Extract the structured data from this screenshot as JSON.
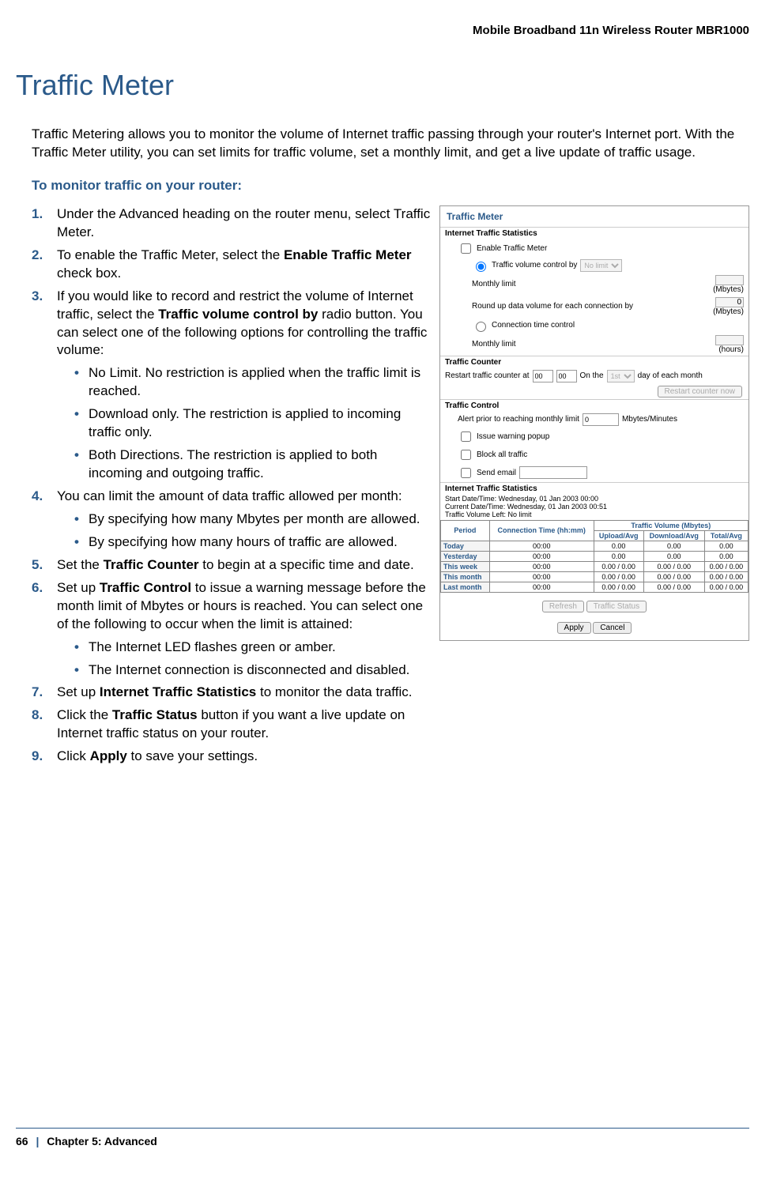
{
  "header": {
    "product": "Mobile Broadband 11n Wireless Router MBR1000"
  },
  "title": "Traffic Meter",
  "intro": "Traffic Metering allows you to monitor the volume of Internet traffic passing through your router's Internet port. With the Traffic Meter utility, you can set limits for traffic volume, set a monthly limit, and get a live update of traffic usage.",
  "sub_heading": "To monitor traffic on your router:",
  "steps": {
    "s1": "Under the Advanced heading on the router menu, select Traffic Meter.",
    "s2_a": "To enable the Traffic Meter, select the ",
    "s2_b": "Enable Traffic Meter",
    "s2_c": " check box.",
    "s3_a": "If you would like to record and restrict the volume of Internet traffic, select the ",
    "s3_b": "Traffic volume control by",
    "s3_c": " radio button. You can select one of the following options for controlling the traffic volume:",
    "s3_bullets": [
      "No Limit. No restriction is applied when the traffic limit is reached.",
      "Download only. The restriction is applied to incoming traffic only.",
      "Both Directions. The restriction is applied to both incoming and outgoing traffic."
    ],
    "s4": "You can limit the amount of data traffic allowed per month:",
    "s4_bullets": [
      "By specifying how many Mbytes per month are allowed.",
      "By specifying how many hours of traffic are allowed."
    ],
    "s5_a": "Set the ",
    "s5_b": "Traffic Counter",
    "s5_c": " to begin at a specific time and date.",
    "s6_a": "Set up ",
    "s6_b": "Traffic Control",
    "s6_c": " to issue a warning message before the month limit of Mbytes or hours is reached. You can select one of the following to occur when the limit is attained:",
    "s6_bullets": [
      "The Internet LED flashes green or amber.",
      "The Internet connection is disconnected and disabled."
    ],
    "s7_a": "Set up ",
    "s7_b": "Internet Traffic Statistics",
    "s7_c": " to monitor the data traffic.",
    "s8_a": "Click the ",
    "s8_b": "Traffic Status",
    "s8_c": " button if you want a live update on Internet traffic status on your router.",
    "s9_a": "Click ",
    "s9_b": "Apply",
    "s9_c": " to save your settings."
  },
  "shot": {
    "title": "Traffic Meter",
    "sec1": "Internet Traffic Statistics",
    "enable": "Enable Traffic Meter",
    "vol_ctrl": "Traffic volume control by",
    "vol_sel": "No limit",
    "monthly_limit": "Monthly limit",
    "mb": "(Mbytes)",
    "roundup": "Round up data volume for each connection by",
    "zero": "0",
    "conn_time": "Connection time control",
    "hours": "(hours)",
    "sec2": "Traffic Counter",
    "restart_a": "Restart traffic counter at",
    "restart_hh": "00",
    "restart_mm": "00",
    "restart_b": "On the",
    "restart_day": "1st",
    "restart_c": "day of each month",
    "restart_btn": "Restart counter now",
    "sec3": "Traffic Control",
    "alert": "Alert prior to reaching monthly limit",
    "alert_val": "0",
    "alert_unit": "Mbytes/Minutes",
    "issue": "Issue warning popup",
    "block": "Block all traffic",
    "send": "Send email",
    "sec4": "Internet Traffic Statistics",
    "start_dt": "Start Date/Time: Wednesday, 01 Jan 2003 00:00",
    "curr_dt": "Current Date/Time: Wednesday, 01 Jan 2003 00:51",
    "vol_left": "Traffic Volume Left: No limit",
    "th_period": "Period",
    "th_ct": "Connection Time (hh:mm)",
    "th_vol": "Traffic Volume (Mbytes)",
    "th_up": "Upload/Avg",
    "th_dn": "Download/Avg",
    "th_tot": "Total/Avg",
    "rows": [
      {
        "p": "Today",
        "ct": "00:00",
        "u": "0.00",
        "d": "0.00",
        "t": "0.00"
      },
      {
        "p": "Yesterday",
        "ct": "00:00",
        "u": "0.00",
        "d": "0.00",
        "t": "0.00"
      },
      {
        "p": "This week",
        "ct": "00:00",
        "u": "0.00 / 0.00",
        "d": "0.00 / 0.00",
        "t": "0.00 / 0.00"
      },
      {
        "p": "This month",
        "ct": "00:00",
        "u": "0.00 / 0.00",
        "d": "0.00 / 0.00",
        "t": "0.00 / 0.00"
      },
      {
        "p": "Last month",
        "ct": "00:00",
        "u": "0.00 / 0.00",
        "d": "0.00 / 0.00",
        "t": "0.00 / 0.00"
      }
    ],
    "refresh": "Refresh",
    "status": "Traffic Status",
    "apply": "Apply",
    "cancel": "Cancel"
  },
  "footer": {
    "page": "66",
    "chapter": "Chapter 5:  Advanced"
  }
}
